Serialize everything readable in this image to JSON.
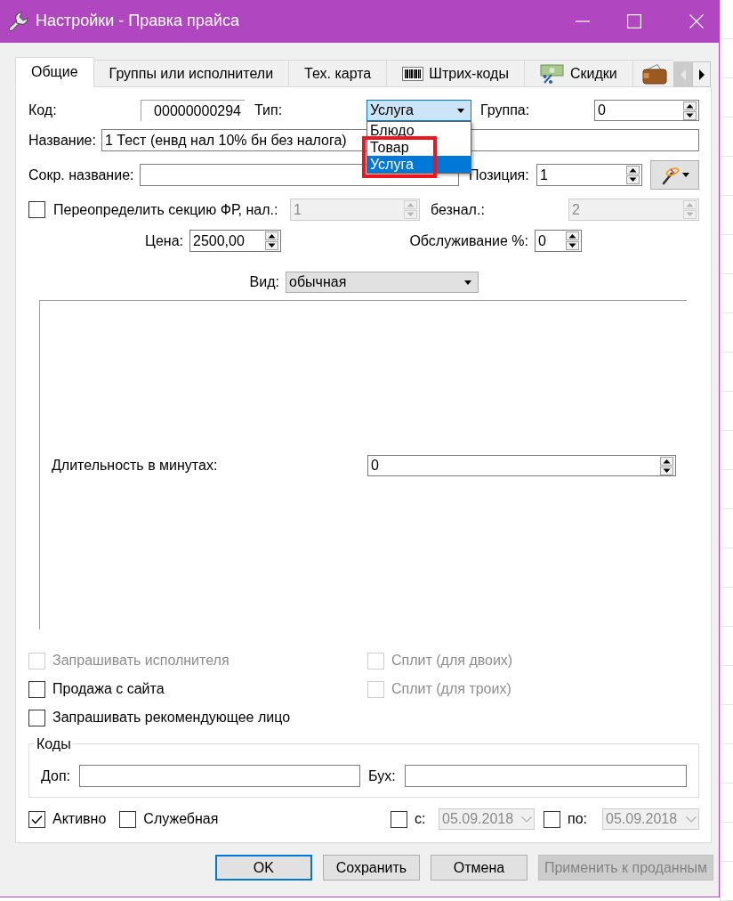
{
  "window": {
    "title": "Настройки - Правка прайса"
  },
  "tabs": [
    {
      "label": "Общие",
      "selected": true,
      "kind": "text"
    },
    {
      "label": "Группы или исполнители",
      "selected": false,
      "kind": "text"
    },
    {
      "label": "Тех. карта",
      "selected": false,
      "kind": "text"
    },
    {
      "label": "Штрих-коды",
      "selected": false,
      "kind": "barcode"
    },
    {
      "label": "Скидки",
      "selected": false,
      "kind": "discount"
    },
    {
      "selected": false,
      "kind": "wallet"
    }
  ],
  "tab_scroll": [
    {
      "kind": "left",
      "disabled": true
    },
    {
      "kind": "right",
      "disabled": false
    }
  ],
  "form": {
    "code": {
      "label": "Код:",
      "value": "00000000294"
    },
    "type": {
      "label": "Тип:",
      "value": "Услуга",
      "focused": true,
      "expanded": true,
      "options": [
        {
          "label": "Блюдо",
          "selected": false,
          "highlighted": false
        },
        {
          "label": "Товар",
          "selected": false,
          "highlighted": true
        },
        {
          "label": "Услуга",
          "selected": true,
          "highlighted": true
        }
      ]
    },
    "group": {
      "label": "Группа:",
      "value": "0"
    },
    "name": {
      "label": "Название:",
      "value": "1 Тест (енвд нал 10% бн без налога)"
    },
    "short_name": {
      "label": "Сокр. название:"
    },
    "position": {
      "label": "Позиция:",
      "value": "1"
    },
    "fr_section": {
      "label": "Переопределить секцию ФР, нал.:",
      "checked": false,
      "value": "1",
      "disabled": true
    },
    "non_cash": {
      "label": "безнал.:",
      "value": "2",
      "disabled": true
    },
    "price": {
      "label": "Цена:",
      "value": "2500,00"
    },
    "service": {
      "label": "Обслуживание %:",
      "value": "0"
    },
    "view": {
      "label": "Вид:",
      "value": "обычная"
    },
    "duration": {
      "label": "Длительность в минутах:",
      "value": "0"
    }
  },
  "options": [
    {
      "label": "Запрашивать исполнителя",
      "checked": false,
      "disabled": true
    },
    {
      "label": "Сплит (для двоих)",
      "checked": false,
      "disabled": true
    },
    {
      "label": "Продажа с сайта",
      "checked": false,
      "disabled": false
    },
    {
      "label": "Сплит (для троих)",
      "checked": false,
      "disabled": true
    },
    {
      "label": "Запрашивать рекомендующее лицо",
      "checked": false,
      "disabled": false
    }
  ],
  "codes": {
    "title": "Коды",
    "fields": [
      {
        "label": "Доп:"
      },
      {
        "label": "Бух:"
      }
    ]
  },
  "flags": [
    {
      "label": "Активно",
      "checked": true
    },
    {
      "label": "Служебная",
      "checked": false
    }
  ],
  "date_range": [
    {
      "label": "с:",
      "checked": false,
      "value": "05.09.2018",
      "disabled": true
    },
    {
      "label": "по:",
      "checked": false,
      "value": "05.09.2018",
      "disabled": true
    }
  ],
  "buttons": [
    {
      "label": "OK",
      "default": true,
      "disabled": false
    },
    {
      "label": "Сохранить",
      "default": false,
      "disabled": false
    },
    {
      "label": "Отмена",
      "default": false,
      "disabled": false
    },
    {
      "label": "Применить к проданным",
      "default": false,
      "disabled": true
    }
  ]
}
